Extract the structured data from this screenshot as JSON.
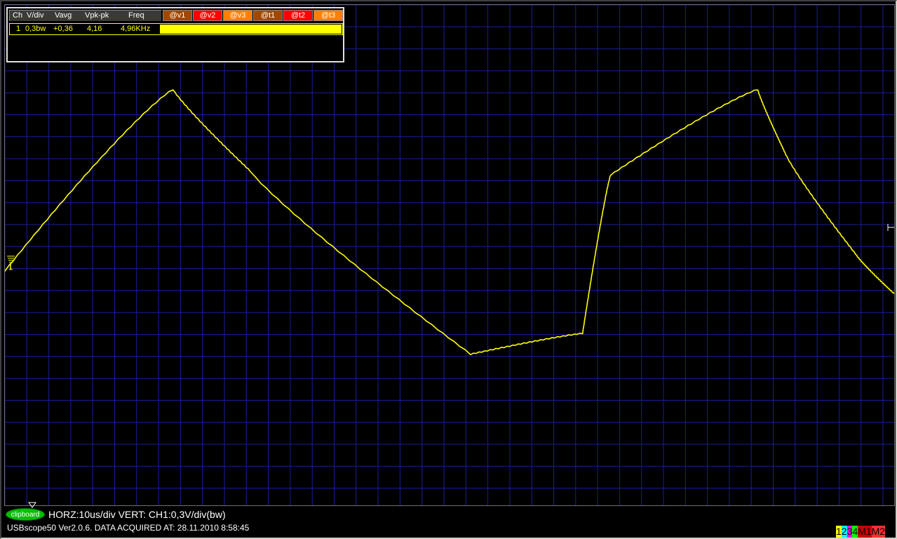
{
  "app": {
    "name": "USBscope50"
  },
  "measurements": {
    "headers": {
      "ch": "Ch",
      "vdiv": "V/div",
      "vavg": "Vavg",
      "vpkpk": "Vpk-pk",
      "freq": "Freq"
    },
    "cursor_buttons": [
      {
        "label": "@v1",
        "color": "#a04800"
      },
      {
        "label": "@v2",
        "color": "#ff0000"
      },
      {
        "label": "@v3",
        "color": "#ff8000"
      },
      {
        "label": "@t1",
        "color": "#a04800"
      },
      {
        "label": "@t2",
        "color": "#ff0000"
      },
      {
        "label": "@t3",
        "color": "#ff8000"
      }
    ],
    "rows": [
      {
        "ch": "1",
        "vdiv": "0,3bw",
        "vavg": "+0,36",
        "vpkpk": "4,16",
        "freq": "4,96KHz"
      }
    ]
  },
  "trace": {
    "color": "#ffff00",
    "grid_color": "#1c1c9c",
    "samples": [
      -0.2,
      4.15,
      2.2,
      -2.2,
      -1.7,
      2.1,
      4.15,
      2.6,
      0.2,
      -0.75
    ],
    "sample_times_div": [
      0,
      4.8,
      7.0,
      13.3,
      16.5,
      17.3,
      21.5,
      22.3,
      24.3,
      25.4
    ],
    "vertical_divisions": 16,
    "horizontal_divisions": 25.4,
    "volts_per_div": 0.3,
    "center_offset_div": 7.0
  },
  "markers": {
    "trigger_level": "T\n1",
    "right_marker": "⊢"
  },
  "clipboard_button": {
    "label": "clipboard",
    "color": "#00c000"
  },
  "settings_text": "HORZ:10us/div VERT: CH1:0,3V/div(bw)",
  "status_text": "USBscope50 Ver2.0.6.  DATA ACQUIRED AT: 28.11.2010 8:58:45",
  "channel_selector": [
    {
      "label": "1",
      "color": "#ffff00",
      "text": "#000"
    },
    {
      "label": "2",
      "color": "#00ffff",
      "text": "#000"
    },
    {
      "label": "3",
      "color": "#ff00ff",
      "text": "#000"
    },
    {
      "label": "4",
      "color": "#00ff00",
      "text": "#000"
    },
    {
      "label": "M1",
      "color": "#cc0000",
      "text": "#000"
    },
    {
      "label": "M2",
      "color": "#ff3030",
      "text": "#000"
    }
  ]
}
